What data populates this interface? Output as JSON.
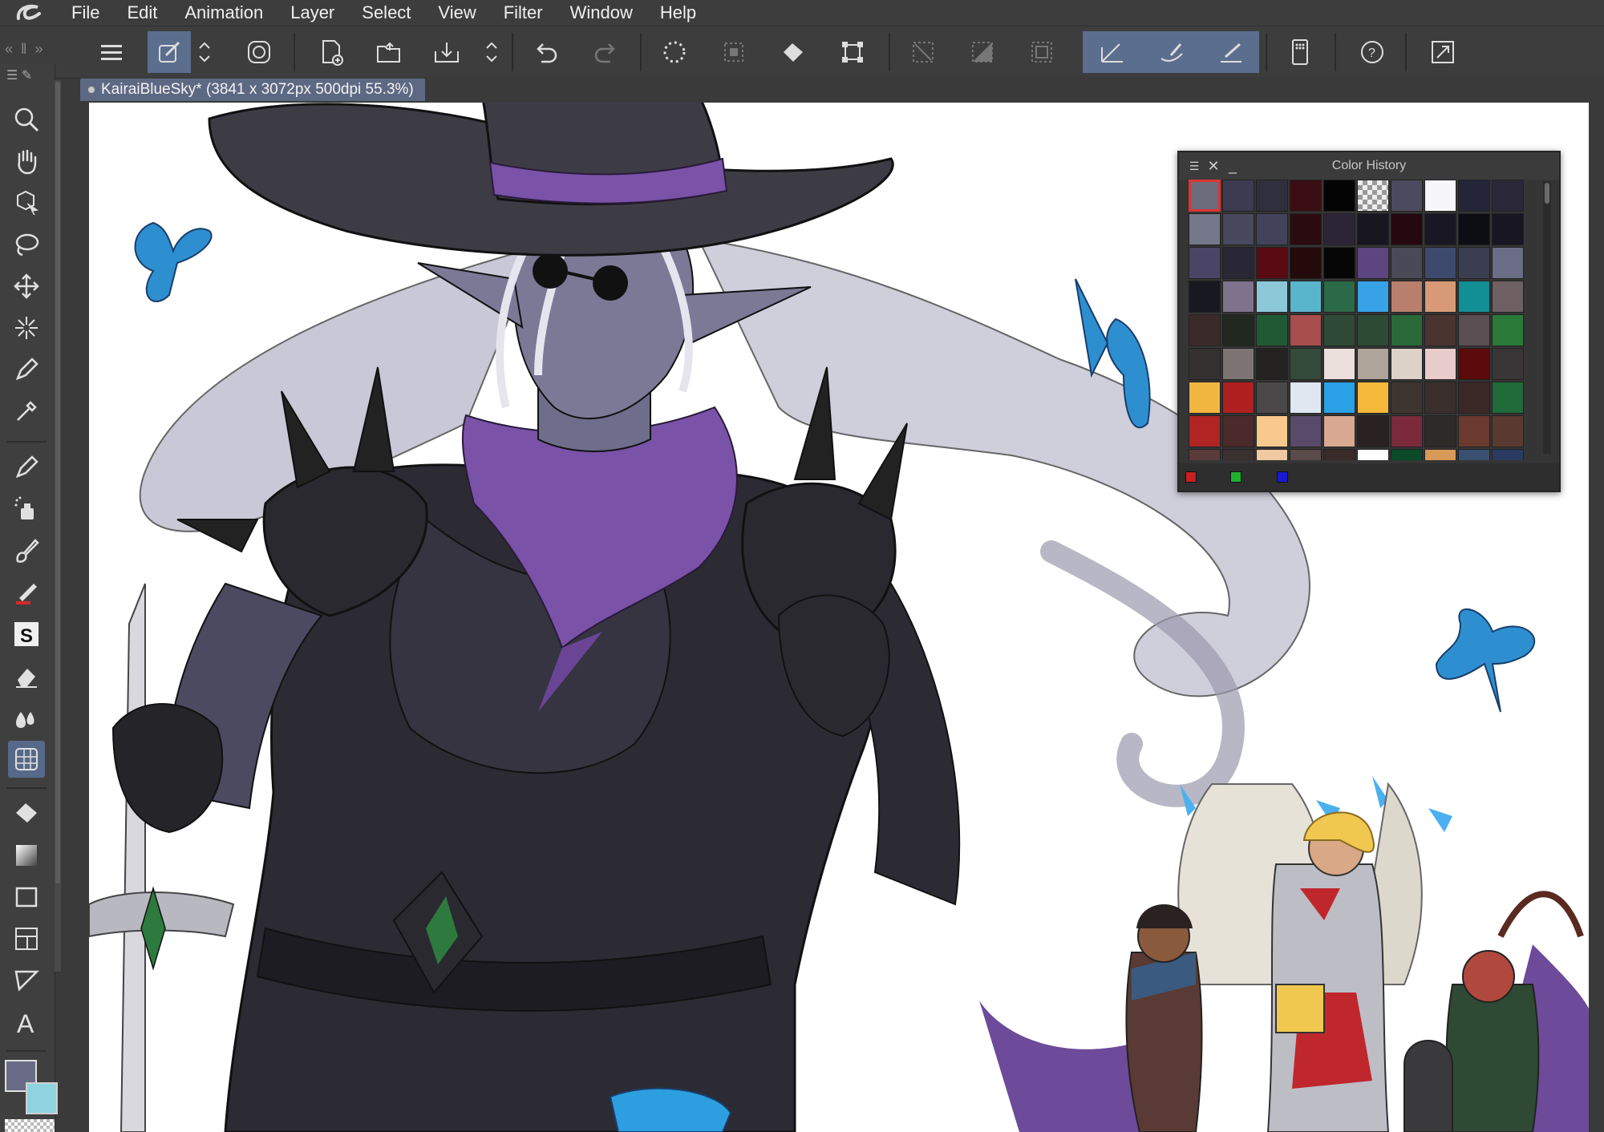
{
  "menubar": {
    "logo_icon": "clip-studio-logo-icon",
    "items": [
      "File",
      "Edit",
      "Animation",
      "Layer",
      "Select",
      "View",
      "Filter",
      "Window",
      "Help"
    ]
  },
  "toolbar": {
    "icons": [
      "menu-icon",
      "brush-settings-icon",
      "spinner-icon",
      "spiral-icon",
      "new-canvas-icon",
      "open-icon",
      "save-icon",
      "save-spinner-icon",
      "undo-icon",
      "redo-icon",
      "select-all-icon",
      "deselect-icon",
      "fill-icon",
      "transform-icon",
      "clear-icon",
      "fill-selection-icon",
      "crop-icon",
      "stabilizer-icon",
      "smoothing-icon",
      "pressure-icon",
      "companion-mode-icon",
      "help-icon",
      "fullscreen-icon"
    ]
  },
  "tab": {
    "title": "KairaiBlueSky* (3841 x 3072px 500dpi 55.3%)"
  },
  "tools": [
    "zoom-icon",
    "hand-icon",
    "object-select-icon",
    "lasso-icon",
    "move-icon",
    "magic-wand-icon",
    "pen-icon",
    "eyedropper-icon",
    "marker-icon",
    "airbrush-icon",
    "brush-icon",
    "decoration-icon",
    "sub-tool-icon",
    "eraser-icon",
    "blend-icon",
    "ruler-icon",
    "fill-bucket-icon",
    "gradient-icon",
    "rectangle-icon",
    "frame-icon",
    "balloon-icon",
    "text-icon"
  ],
  "colors": {
    "main": "#6a6c86",
    "sub": "#8fd3e0",
    "accent": "#5b6e8e"
  },
  "color_history": {
    "title": "Color History",
    "swatches": [
      "#6b6c7c",
      "#3c3b52",
      "#2f2f3e",
      "#3a0d12",
      "#040404",
      "transparent",
      "#4b4a5e",
      "#f7f7fb",
      "#25253a",
      "#2a2838",
      "#75778a",
      "#48485e",
      "#42435a",
      "#2a0c10",
      "#2c2538",
      "#181620",
      "#250810",
      "#1a1724",
      "#0d0d14",
      "#191623",
      "#4a4466",
      "#292735",
      "#5a0a12",
      "#250a0c",
      "#060606",
      "#5d4580",
      "#4a4957",
      "#3d4a6d",
      "#3b3d50",
      "#6b6e86",
      "#181820",
      "#7f728d",
      "#8bc9d8",
      "#58b5cc",
      "#2b6a48",
      "#38a2e6",
      "#b8806c",
      "#d89a76",
      "#128f95",
      "#6e6062",
      "#3a2a2a",
      "#20281f",
      "#1f5a34",
      "#a84e4d",
      "#2f4a36",
      "#2d4a35",
      "#2a6a3a",
      "#4a3430",
      "#5b4e52",
      "#2a7a3a",
      "#343030",
      "#7d7574",
      "#242121",
      "#344a3a",
      "#ece0dc",
      "#aea49a",
      "#ddd2c8",
      "#e8cbcb",
      "#5a0a0a",
      "#3a3638",
      "#f0b640",
      "#b02020",
      "#4a4848",
      "#dfe8f0",
      "#2aa0e6",
      "#f5b83a",
      "#3f3530",
      "#3a2e2c",
      "#3a2826",
      "#1f6a38",
      "#b02424",
      "#4a2a2a",
      "#f8c98c",
      "#5a4a6a",
      "#d8a890",
      "#2a2222",
      "#7a2a3a",
      "#2e2a28",
      "#6a3a2e",
      "#5a3a30",
      "#5a3a3a",
      "#3a3030",
      "#f0c9a0",
      "#5a4a4a",
      "#3a2a2a",
      "#ffffff",
      "#0a4a28",
      "#d89a58",
      "#3a5070",
      "#2a3a60"
    ],
    "footer_marks": [
      "#c82020",
      "#20b030",
      "#1a1ad0"
    ]
  }
}
